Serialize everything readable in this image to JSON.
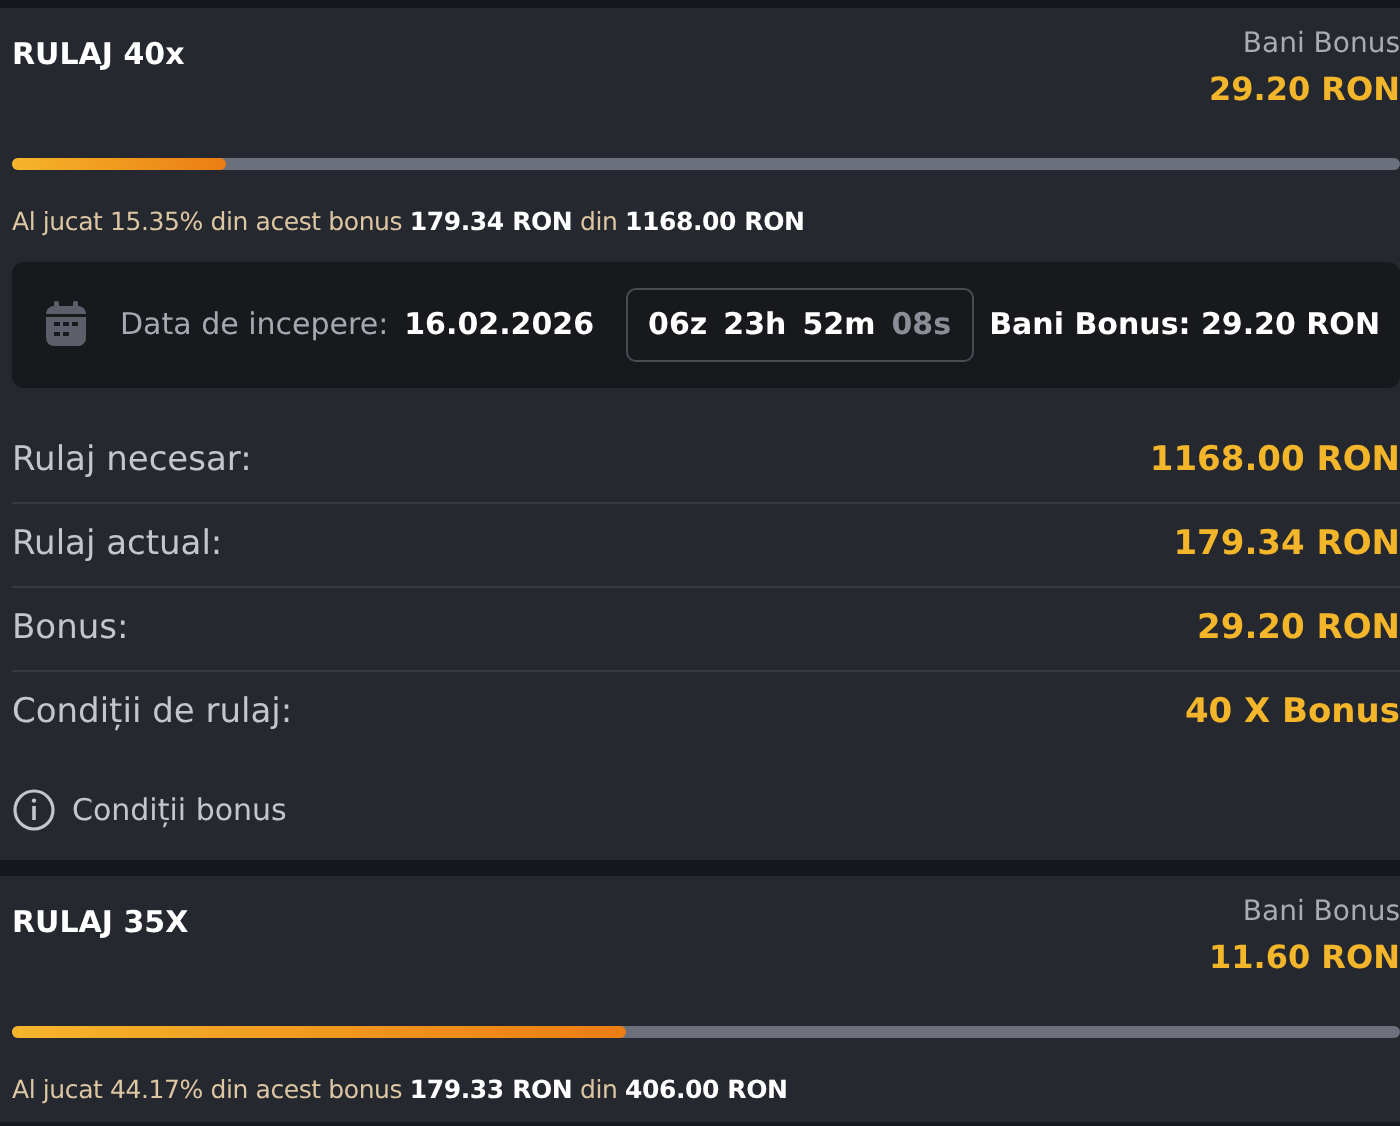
{
  "bonuses": [
    {
      "title": "RULAJ 40x",
      "side_label": "Bani Bonus",
      "side_amount": "29.20 RON",
      "level": 0.1535,
      "summary": "Al jucat 15.35% din acest bonus **179.34 RON** din **1168.00 RON**",
      "info": {
        "start_label": "Data de incepere:",
        "start_date": "16.02.2026",
        "timer": [
          {
            "text": "06z",
            "dim": false
          },
          {
            "text": "23h",
            "dim": false
          },
          {
            "text": "52m",
            "dim": false
          },
          {
            "text": "08s",
            "dim": true
          }
        ],
        "bonus_money": "Bani Bonus: 29.20 RON"
      },
      "details": [
        {
          "label": "Rulaj necesar:",
          "value": "1168.00 RON"
        },
        {
          "label": "Rulaj actual:",
          "value": "179.34 RON"
        },
        {
          "label": "Bonus:",
          "value": "29.20 RON"
        },
        {
          "label": "Condiții de rulaj:",
          "value": "40 X Bonus"
        }
      ],
      "conditions_link": "Condiții bonus"
    },
    {
      "title": "RULAJ 35X",
      "side_label": "Bani Bonus",
      "side_amount": "11.60 RON",
      "level": 0.4417,
      "summary": "Al jucat 44.17% din acest bonus **179.33 RON** din **406.00 RON**"
    }
  ]
}
